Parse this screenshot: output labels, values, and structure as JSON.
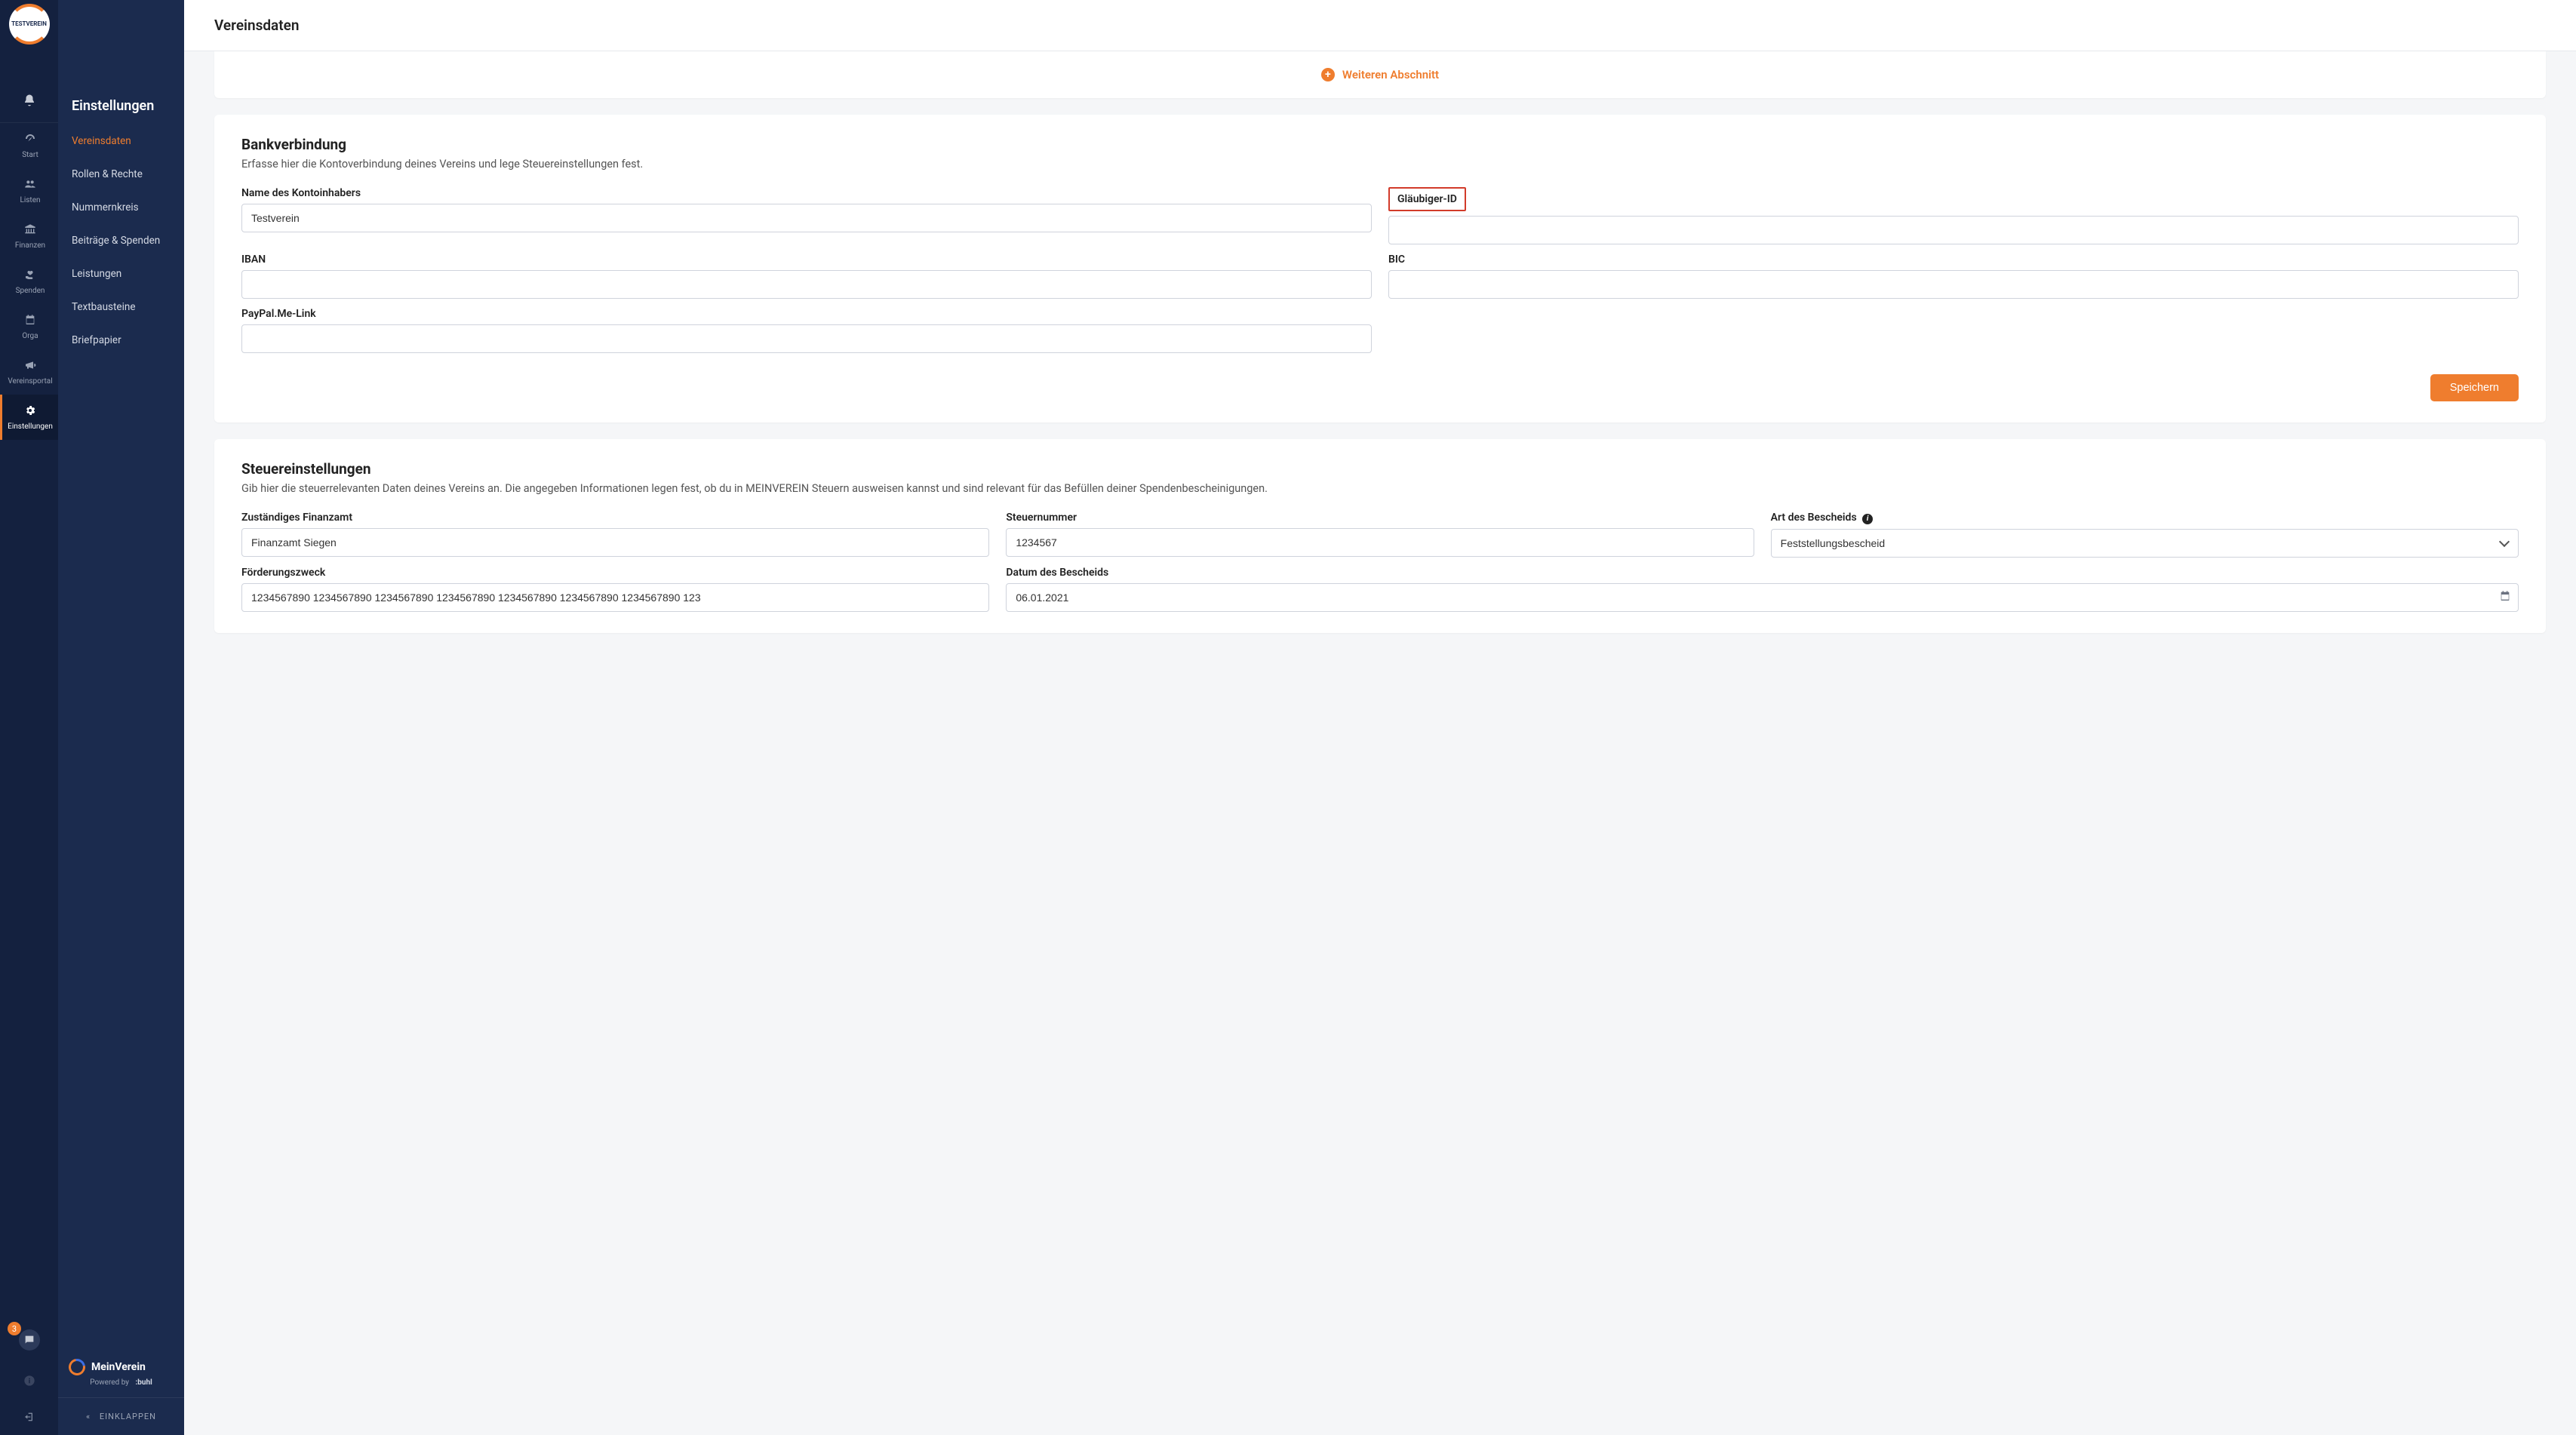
{
  "org_logo_text": "TESTVEREIN",
  "rail": {
    "bell": "bell",
    "items": [
      {
        "icon": "dashboard",
        "label": "Start"
      },
      {
        "icon": "users",
        "label": "Listen"
      },
      {
        "icon": "bank",
        "label": "Finanzen"
      },
      {
        "icon": "heart-hand",
        "label": "Spenden"
      },
      {
        "icon": "calendar",
        "label": "Orga"
      },
      {
        "icon": "megaphone",
        "label": "Vereinsportal"
      },
      {
        "icon": "gear",
        "label": "Einstellungen"
      }
    ],
    "active_index": 6,
    "chat_count": "3"
  },
  "sidebar": {
    "title": "Einstellungen",
    "items": [
      "Vereinsdaten",
      "Rollen & Rechte",
      "Nummernkreis",
      "Beiträge & Spenden",
      "Leistungen",
      "Textbausteine",
      "Briefpapier"
    ],
    "active_index": 0,
    "brand": "MeinVerein",
    "powered_prefix": "Powered by",
    "powered_brand": ":buhl",
    "collapse": "EINKLAPPEN"
  },
  "page": {
    "title": "Vereinsdaten",
    "add_section": "Weiteren Abschnitt"
  },
  "bank": {
    "title": "Bankverbindung",
    "subtitle": "Erfasse hier die Kontoverbindung deines Vereins und lege Steuereinstellungen fest.",
    "labels": {
      "holder": "Name des Kontoinhabers",
      "creditor_id": "Gläubiger-ID",
      "iban": "IBAN",
      "bic": "BIC",
      "paypal": "PayPal.Me-Link"
    },
    "values": {
      "holder": "Testverein",
      "creditor_id": "",
      "iban": "",
      "bic": "",
      "paypal": ""
    },
    "save": "Speichern"
  },
  "tax": {
    "title": "Steuereinstellungen",
    "subtitle": "Gib hier die steuerrelevanten Daten deines Vereins an. Die angegeben Informationen legen fest, ob du in MEINVEREIN Steuern ausweisen kannst und sind relevant für das Befüllen deiner Spendenbescheinigungen.",
    "labels": {
      "tax_office": "Zuständiges Finanzamt",
      "tax_number": "Steuernummer",
      "decision_type": "Art des Bescheids",
      "purpose": "Förderungszweck",
      "decision_date": "Datum des Bescheids"
    },
    "values": {
      "tax_office": "Finanzamt Siegen",
      "tax_number": "1234567",
      "decision_type": "Feststellungsbescheid",
      "purpose": "1234567890 1234567890 1234567890 1234567890 1234567890 1234567890 1234567890 123",
      "decision_date": "06.01.2021"
    }
  }
}
